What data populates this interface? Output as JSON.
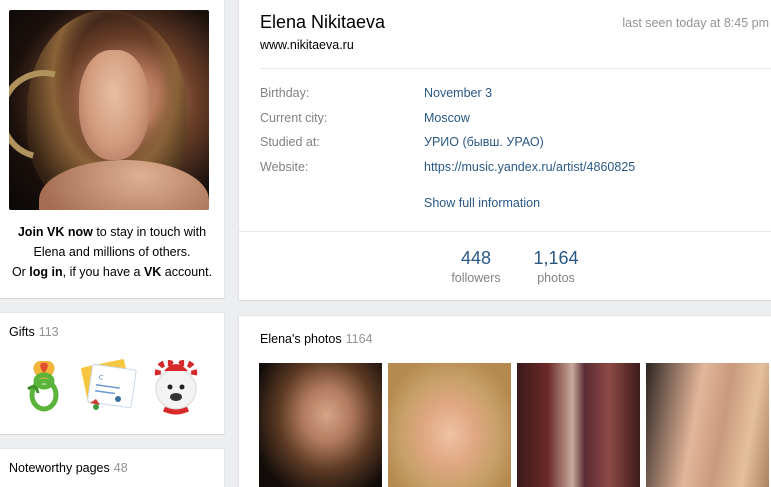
{
  "left": {
    "join": {
      "pre": "Join VK now",
      "mid": " to stay in touch with Elena and millions of others.",
      "or": "Or ",
      "login": "log in",
      "mid2": ", if you have a ",
      "vk": "VK",
      "end": " account."
    },
    "gifts": {
      "title": "Gifts",
      "count": "113",
      "items": [
        "flower-8-gift-icon",
        "greeting-card-gift-icon",
        "bear-candy-cane-gift-icon"
      ]
    },
    "noteworthy": {
      "title": "Noteworthy pages",
      "count": "48"
    }
  },
  "profile": {
    "name": "Elena Nikitaeva",
    "website_line": "www.nikitaeva.ru",
    "last_seen": "last seen today at 8:45 pm",
    "info": [
      {
        "label": "Birthday:",
        "value": "November 3"
      },
      {
        "label": "Current city:",
        "value": "Moscow"
      },
      {
        "label": "Studied at:",
        "value": "УРИО (бывш. УРАО)"
      },
      {
        "label": "Website:",
        "value": "https://music.yandex.ru/artist/4860825"
      }
    ],
    "show_full": "Show full information",
    "counters": [
      {
        "num": "448",
        "unit": "followers"
      },
      {
        "num": "1,164",
        "unit": "photos"
      }
    ]
  },
  "photos": {
    "title": "Elena's photos",
    "count": "1164"
  },
  "colors": {
    "link": "#2a5885",
    "muted": "#828282",
    "page_bg": "#edeef0"
  }
}
